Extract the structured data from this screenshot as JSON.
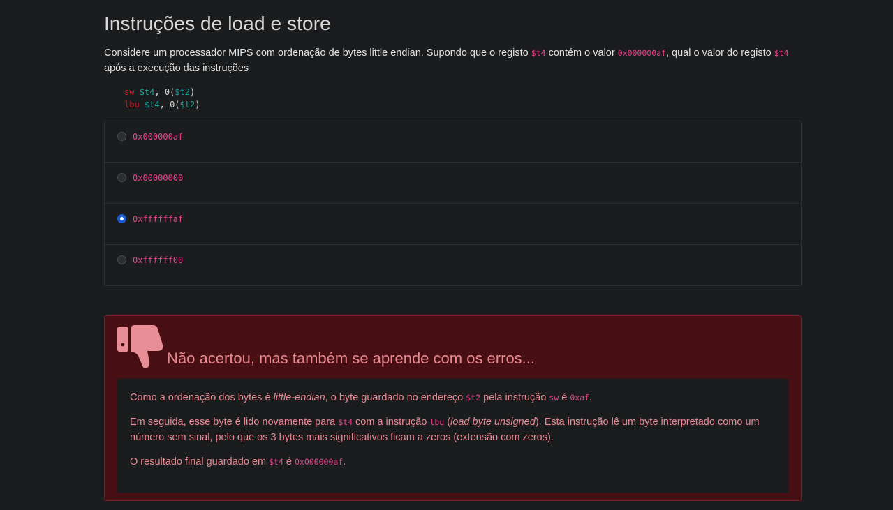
{
  "title": "Instruções de load e store",
  "question": {
    "part1": "Considere um processador MIPS com ordenação de bytes little endian. Supondo que o registo ",
    "reg1": "$t4",
    "part2": " contém o valor ",
    "val1": "0x000000af",
    "part3": ", qual o valor do registo ",
    "reg2": "$t4",
    "part4": " após a execução das instruções"
  },
  "code": {
    "line1": {
      "op": "sw",
      "r1": "$t4",
      "sep": ", ",
      "off": "0",
      "open": "(",
      "r2": "$t2",
      "close": ")"
    },
    "line2": {
      "op": "lbu",
      "r1": "$t4",
      "sep": ", ",
      "off": "0",
      "open": "(",
      "r2": "$t2",
      "close": ")"
    }
  },
  "options": [
    {
      "label": "0x000000af",
      "selected": false
    },
    {
      "label": "0x00000000",
      "selected": false
    },
    {
      "label": "0xffffffaf",
      "selected": true
    },
    {
      "label": "0xffffff00",
      "selected": false
    }
  ],
  "feedback": {
    "icon": "thumbs-down-icon",
    "title": "Não acertou, mas também se aprende com os erros...",
    "p1": {
      "a": "Como a ordenação dos bytes é ",
      "em": "little-endian",
      "b": ", o byte guardado no endereço ",
      "c1": "$t2",
      "c": " pela instrução ",
      "c2": "sw",
      "d": " é ",
      "c3": "0xaf",
      "e": "."
    },
    "p2": {
      "a": "Em seguida, esse byte é lido novamente para ",
      "c1": "$t4",
      "b": " com a instrução ",
      "c2": "lbu",
      "c": " (",
      "em": "load byte unsigned",
      "d": "). Esta instrução lê um byte interpretado como um número sem sinal, pelo que os 3 bytes mais significativos ficam a zeros (extensão com zeros)."
    },
    "p3": {
      "a": "O resultado final guardado em ",
      "c1": "$t4",
      "b": " é ",
      "c2": "0x000000af",
      "c": "."
    }
  },
  "colors": {
    "background": "#1b1c1e",
    "inline_code": "#e8438c",
    "opcode": "#c8202b",
    "register": "#1aa39a",
    "feedback_bg": "#470e13",
    "feedback_text": "#ea8891",
    "radio_selected": "#1a5cd6"
  }
}
